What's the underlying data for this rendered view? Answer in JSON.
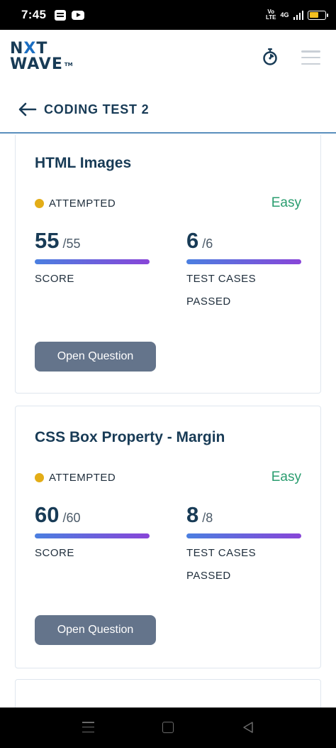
{
  "status_bar": {
    "time": "7:45",
    "volte_line1": "Vo",
    "volte_line2": "LTE",
    "network": "4G",
    "battery_level": 0.6,
    "icons": [
      "document-icon",
      "youtube-icon",
      "signal-icon",
      "battery-icon"
    ]
  },
  "header": {
    "logo_line1_a": "N",
    "logo_line1_b": "X",
    "logo_line1_c": "T",
    "logo_line2": "WAVE",
    "logo_tm": "TM",
    "icons": [
      "timer-icon",
      "menu-icon"
    ]
  },
  "test": {
    "title": "CODING TEST 2"
  },
  "questions": [
    {
      "title": "HTML Images",
      "status": "ATTEMPTED",
      "difficulty": "Easy",
      "score": "55",
      "score_total": "/55",
      "score_label": "SCORE",
      "score_fraction": 1.0,
      "tests_passed": "6",
      "tests_total": "/6",
      "tests_label_line1": "TEST CASES",
      "tests_label_line2": "PASSED",
      "tests_fraction": 1.0,
      "button": "Open Question"
    },
    {
      "title": "CSS Box Property - Margin",
      "status": "ATTEMPTED",
      "difficulty": "Easy",
      "score": "60",
      "score_total": "/60",
      "score_label": "SCORE",
      "score_fraction": 1.0,
      "tests_passed": "8",
      "tests_total": "/8",
      "tests_label_line1": "TEST CASES",
      "tests_label_line2": "PASSED",
      "tests_fraction": 1.0,
      "button": "Open Question"
    }
  ],
  "colors": {
    "brand_navy": "#183b56",
    "status_attempted": "#e3ad17",
    "difficulty_easy": "#2a9d6f",
    "button_bg": "#64748b",
    "progress_start": "#4b7fe0",
    "progress_end": "#8845d8"
  }
}
